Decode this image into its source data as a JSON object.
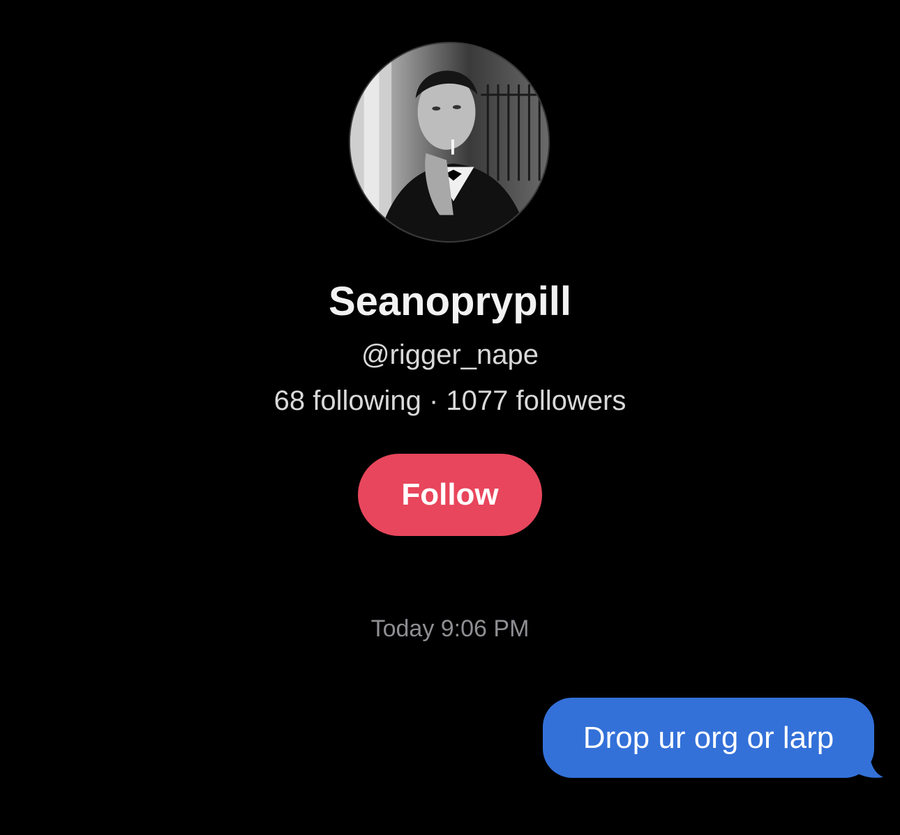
{
  "profile": {
    "display_name": "Seanoprypill",
    "handle": "@rigger_nape",
    "following_count": "68 following",
    "separator": " · ",
    "followers_count": "1077 followers",
    "avatar_icon": "profile-photo"
  },
  "actions": {
    "follow_label": "Follow",
    "follow_color": "#e8465c"
  },
  "conversation": {
    "timestamp": "Today 9:06 PM",
    "messages": [
      {
        "text": "Drop ur org or larp",
        "sender": "me",
        "bubble_color": "#3371d9"
      }
    ]
  },
  "theme": {
    "background": "#000000",
    "text_primary": "#f2f2f2",
    "text_secondary": "#d9d9d9",
    "text_muted": "#8e8e93"
  }
}
